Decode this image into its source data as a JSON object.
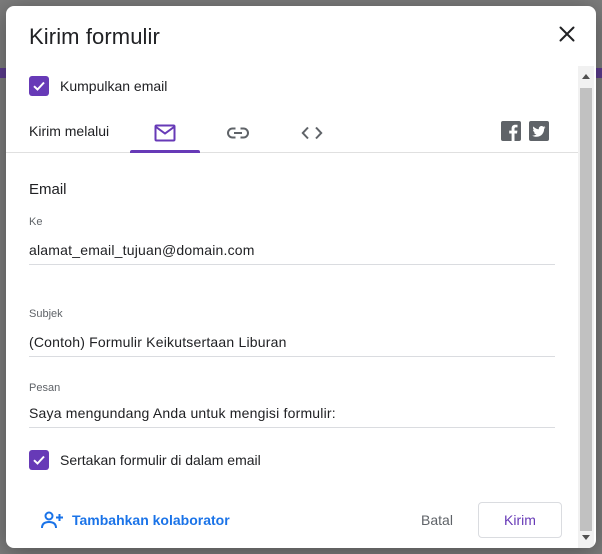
{
  "dialog": {
    "title": "Kirim formulir",
    "collect_email_label": "Kumpulkan email",
    "collect_email_checked": true
  },
  "send_via": {
    "label": "Kirim melalui",
    "tabs": [
      {
        "icon": "mail-icon",
        "active": true
      },
      {
        "icon": "link-icon",
        "active": false
      },
      {
        "icon": "embed-code-icon",
        "active": false
      }
    ],
    "social": [
      "facebook-icon",
      "twitter-icon"
    ]
  },
  "email": {
    "section_title": "Email",
    "to_label": "Ke",
    "to_value": "alamat_email_tujuan@domain.com",
    "subject_label": "Subjek",
    "subject_value": "(Contoh) Formulir Keikutsertaan Liburan",
    "message_label": "Pesan",
    "message_value": "Saya mengundang Anda untuk mengisi formulir:",
    "include_form_label": "Sertakan formulir di dalam email",
    "include_form_checked": true
  },
  "footer": {
    "add_collaborator_label": "Tambahkan kolaborator",
    "cancel_label": "Batal",
    "send_label": "Kirim"
  },
  "colors": {
    "accent": "#673ab7",
    "link": "#1a73e8"
  }
}
